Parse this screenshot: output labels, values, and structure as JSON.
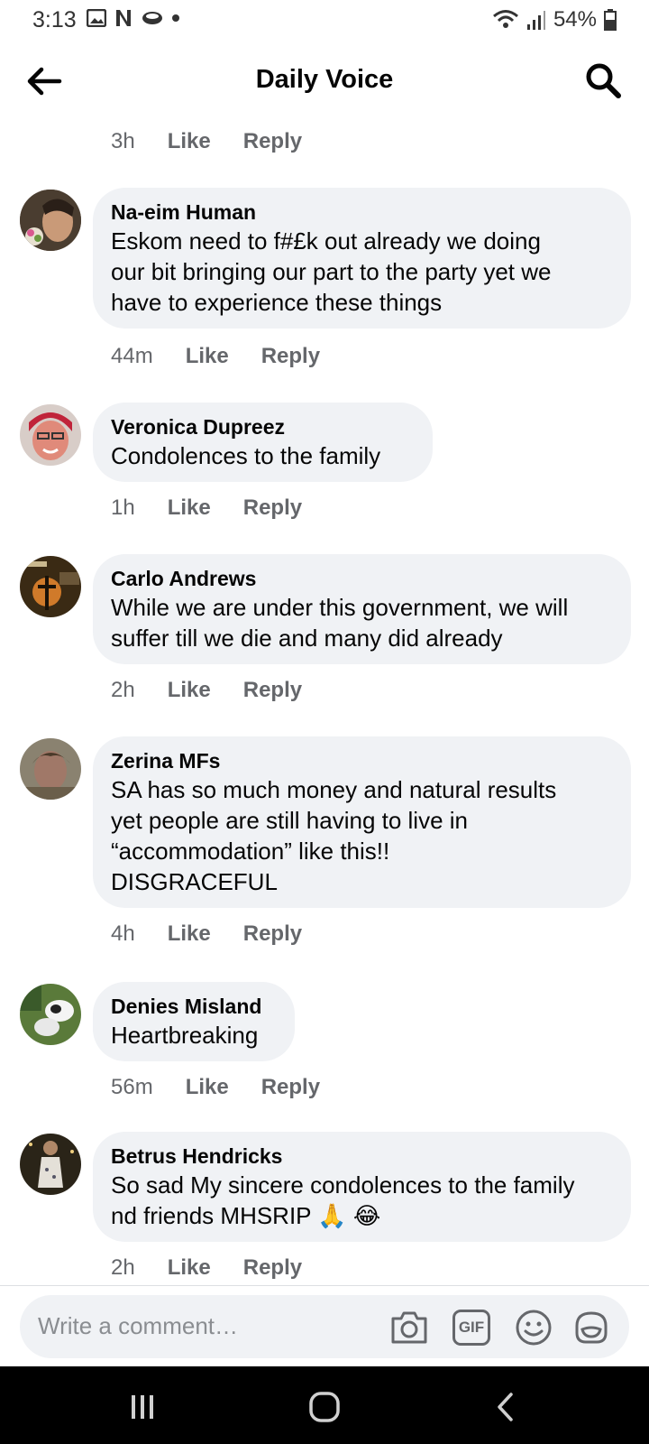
{
  "status_bar": {
    "time": "3:13",
    "battery": "54%"
  },
  "header": {
    "title": "Daily Voice"
  },
  "top_partial": {
    "time": "3h",
    "like": "Like",
    "reply": "Reply"
  },
  "comments": [
    {
      "author": "Na-eim Human",
      "lines": [
        "Eskom need to f#£k out already we doing",
        "our bit bringing our part to the party yet we",
        "have to experience these things"
      ],
      "time": "44m",
      "like": "Like",
      "reply": "Reply"
    },
    {
      "author": "Veronica Dupreez",
      "lines": [
        "Condolences to the family"
      ],
      "time": "1h",
      "like": "Like",
      "reply": "Reply"
    },
    {
      "author": "Carlo Andrews",
      "lines": [
        "While we are under this government, we will",
        "suffer till we die and many did already"
      ],
      "time": "2h",
      "like": "Like",
      "reply": "Reply"
    },
    {
      "author": "Zerina MFs",
      "lines": [
        "SA has so much money and natural results",
        "yet people are still having to live in",
        "“accommodation” like this!!",
        "DISGRACEFUL"
      ],
      "time": "4h",
      "like": "Like",
      "reply": "Reply"
    },
    {
      "author": "Denies Misland",
      "lines": [
        "Heartbreaking"
      ],
      "time": "56m",
      "like": "Like",
      "reply": "Reply"
    },
    {
      "author": "Betrus Hendricks",
      "lines": [
        "So sad My sincere condolences to the family",
        "nd friends MHSRIP 🙏 😂"
      ],
      "time": "2h",
      "like": "Like",
      "reply": "Reply"
    }
  ],
  "composer": {
    "placeholder": "Write a comment…",
    "gif_label": "GIF"
  }
}
